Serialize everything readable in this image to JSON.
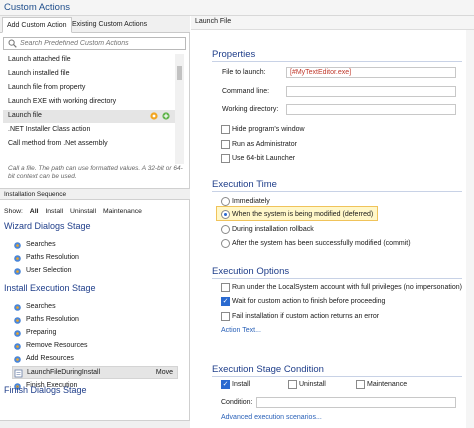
{
  "window": {
    "title": "Custom Actions"
  },
  "left_panel": {
    "tabs": [
      "Add Custom Action",
      "Existing Custom Actions"
    ],
    "search": {
      "placeholder": "Search Predefined Custom Actions"
    },
    "predefined_items": [
      "Launch attached file",
      "Launch installed file",
      "Launch file from property",
      "Launch EXE with working directory",
      "Launch file",
      ".NET Installer Class action",
      "Call method from .Net assembly"
    ],
    "selected_predefined": "Launch file",
    "description": "Call a file. The path can use formatted values. A 32-bit or 64-bit context can be used.",
    "sequence": {
      "title": "Installation Sequence",
      "show_label": "Show:",
      "filters": [
        "All",
        "Install",
        "Uninstall",
        "Maintenance"
      ],
      "active_filter": "All",
      "stages": [
        {
          "title": "Wizard Dialogs Stage",
          "items": [
            "Searches",
            "Paths Resolution",
            "User Selection"
          ]
        },
        {
          "title": "Install Execution Stage",
          "items": [
            "Searches",
            "Paths Resolution",
            "Preparing",
            "Remove Resources",
            "Add Resources",
            "LaunchFileDuringInstall",
            "Finish Execution"
          ]
        },
        {
          "title": "Finish Dialogs Stage",
          "items": []
        }
      ],
      "selected_item": "LaunchFileDuringInstall",
      "move_label": "Move"
    }
  },
  "right_panel": {
    "header": "Launch File",
    "properties": {
      "title": "Properties",
      "file_to_launch_label": "File to launch:",
      "file_to_launch_value": "[#MyTextEditor.exe]",
      "command_line_label": "Command line:",
      "working_dir_label": "Working directory:",
      "options": [
        {
          "label": "Hide program's window",
          "checked": false
        },
        {
          "label": "Run as Administrator",
          "checked": false
        },
        {
          "label": "Use 64-bit Launcher",
          "checked": false
        }
      ]
    },
    "execution_time": {
      "title": "Execution Time",
      "options": [
        "Immediately",
        "When the system is being modified (deferred)",
        "During installation rollback",
        "After the system has been successfully modified (commit)"
      ],
      "selected": "When the system is being modified (deferred)"
    },
    "execution_options": {
      "title": "Execution Options",
      "options": [
        {
          "label": "Run under the LocalSystem account with full privileges (no impersonation)",
          "checked": false
        },
        {
          "label": "Wait for custom action to finish before proceeding",
          "checked": true
        },
        {
          "label": "Fail installation if custom action returns an error",
          "checked": false
        }
      ],
      "action_text_link": "Action Text..."
    },
    "execution_stage_condition": {
      "title": "Execution Stage Condition",
      "options": [
        {
          "label": "Install",
          "checked": true
        },
        {
          "label": "Uninstall",
          "checked": false
        },
        {
          "label": "Maintenance",
          "checked": false
        }
      ],
      "condition_label": "Condition:",
      "advanced_link": "Advanced execution scenarios..."
    }
  },
  "colors": {
    "accent": "#1f3e8a",
    "highlight": "#fff7c9",
    "link": "#2a61b8",
    "check": "#2a6ad0"
  }
}
